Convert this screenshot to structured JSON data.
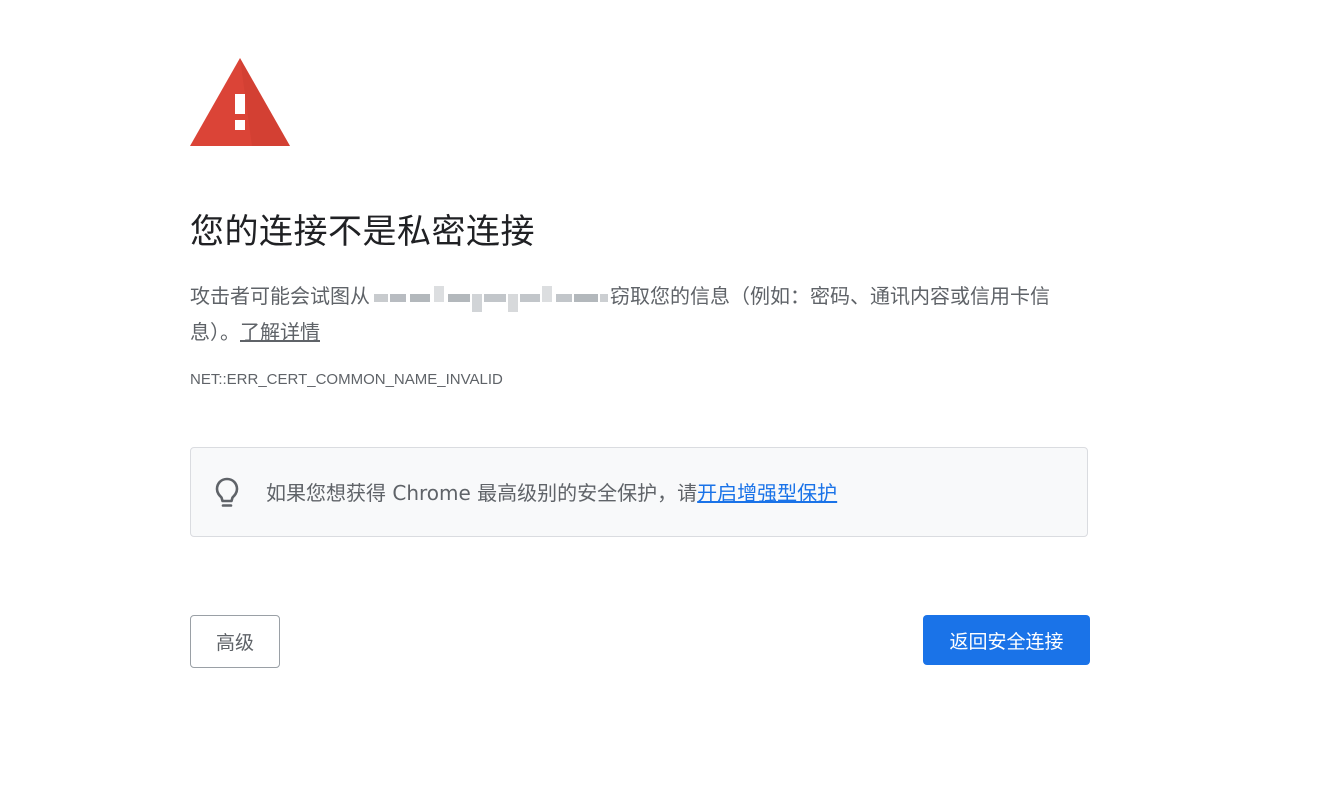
{
  "interstitial": {
    "heading": "您的连接不是私密连接",
    "explanation_before": "攻击者可能会试图从",
    "explanation_after": "窃取您的信息（例如：密码、通讯内容或信用卡信息）。",
    "learn_more": "了解详情",
    "error_code": "NET::ERR_CERT_COMMON_NAME_INVALID"
  },
  "tip": {
    "text": "如果您想获得 Chrome 最高级别的安全保护，请",
    "link": "开启增强型保护"
  },
  "buttons": {
    "advanced": "高级",
    "back_to_safety": "返回安全连接"
  },
  "colors": {
    "warning_red": "#db4437",
    "primary_blue": "#1a73e8",
    "text_gray": "#5f6368",
    "heading_text": "#202124",
    "tip_background": "#f8f9fa"
  },
  "icons": {
    "warning": "warning-triangle-icon",
    "tip": "lightbulb-icon"
  }
}
